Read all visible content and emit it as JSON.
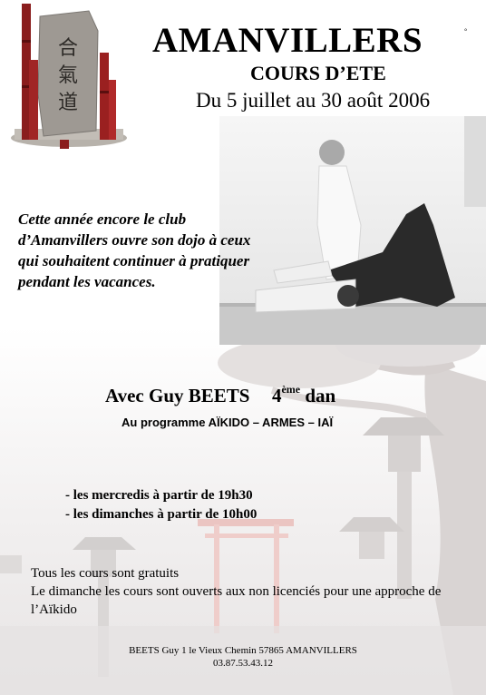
{
  "header": {
    "title": "AMANVILLERS",
    "title_mark": "°",
    "subtitle": "COURS D’ETE",
    "dates": "Du 5 juillet au 30 août 2006"
  },
  "intro": {
    "lines": [
      "Cette année encore  le club",
      "d’Amanvillers ouvre son dojo à ceux",
      "qui souhaitent continuer à pratiquer",
      "pendant les vacances."
    ]
  },
  "teacher": {
    "name": "Avec Guy BEETS",
    "grade_num": "4",
    "grade_sup": "ème",
    "grade_word": "dan"
  },
  "program": "Au programme AÏKIDO – ARMES – IAÏ",
  "schedule": [
    "- les mercredis à partir de 19h30",
    "- les dimanches à partir de 10h00"
  ],
  "info": {
    "line1": "Tous les cours sont gratuits",
    "line2": "Le dimanche les cours sont ouverts aux non licenciés pour une approche de l’Aïkido"
  },
  "footer": {
    "address": "BEETS Guy 1 le Vieux Chemin 57865 AMANVILLERS",
    "phone": "03.87.53.43.12"
  },
  "images": {
    "stone_glyphs": [
      "合",
      "氣",
      "道"
    ]
  }
}
